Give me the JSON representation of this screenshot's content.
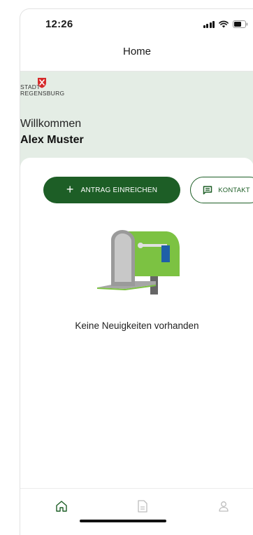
{
  "status_bar": {
    "time": "12:26",
    "signal_icon": "signal-icon",
    "wifi_icon": "wifi-icon",
    "battery_icon": "battery-icon"
  },
  "navbar": {
    "title": "Home"
  },
  "header": {
    "logo_line1": "STADT",
    "logo_line2": "REGENSBURG",
    "welcome": "Willkommen",
    "user_name": "Alex Muster"
  },
  "actions": {
    "submit_label": "ANTRAG EINREICHEN",
    "contact_label": "KONTAKT"
  },
  "empty_state": {
    "message": "Keine Neuigkeiten vorhanden"
  },
  "tabbar": {
    "items": [
      "home-icon",
      "document-icon",
      "profile-icon"
    ],
    "active_index": 0
  },
  "colors": {
    "primary": "#1d5e26",
    "header_bg": "#e4ede5",
    "logo_red": "#d52b2b",
    "mailbox_green": "#7cc242"
  }
}
